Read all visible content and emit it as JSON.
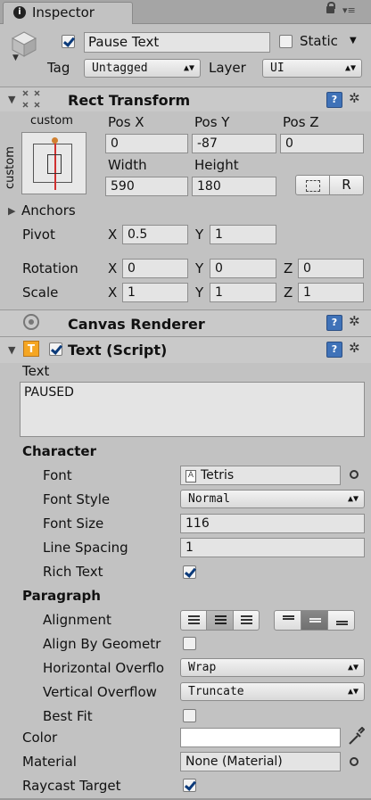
{
  "tab": {
    "title": "Inspector"
  },
  "header": {
    "object_name": "Pause Text",
    "static_label": "Static",
    "tag_label": "Tag",
    "tag_value": "Untagged",
    "layer_label": "Layer",
    "layer_value": "UI"
  },
  "rect_transform": {
    "title": "Rect Transform",
    "anchor_top": "custom",
    "anchor_side": "custom",
    "pos_x_label": "Pos X",
    "pos_y_label": "Pos Y",
    "pos_z_label": "Pos Z",
    "pos_x": "0",
    "pos_y": "-87",
    "pos_z": "0",
    "width_label": "Width",
    "height_label": "Height",
    "width": "590",
    "height": "180",
    "r_label": "R",
    "anchors_label": "Anchors",
    "pivot_label": "Pivot",
    "pivot_x": "0.5",
    "pivot_y": "1",
    "rotation_label": "Rotation",
    "rot_x": "0",
    "rot_y": "0",
    "rot_z": "0",
    "scale_label": "Scale",
    "scale_x": "1",
    "scale_y": "1",
    "scale_z": "1",
    "x": "X",
    "y": "Y",
    "z": "Z"
  },
  "canvas_renderer": {
    "title": "Canvas Renderer"
  },
  "text_script": {
    "title": "Text (Script)",
    "text_label": "Text",
    "text_value": "PAUSED",
    "character_label": "Character",
    "font_label": "Font",
    "font_value": "Tetris",
    "font_style_label": "Font Style",
    "font_style_value": "Normal",
    "font_size_label": "Font Size",
    "font_size_value": "116",
    "line_spacing_label": "Line Spacing",
    "line_spacing_value": "1",
    "rich_text_label": "Rich Text",
    "paragraph_label": "Paragraph",
    "alignment_label": "Alignment",
    "align_geom_label": "Align By Geometr",
    "h_overflow_label": "Horizontal Overflo",
    "h_overflow_value": "Wrap",
    "v_overflow_label": "Vertical Overflow",
    "v_overflow_value": "Truncate",
    "best_fit_label": "Best Fit",
    "color_label": "Color",
    "color_value": "#ffffff",
    "material_label": "Material",
    "material_value": "None (Material)",
    "raycast_label": "Raycast Target"
  }
}
